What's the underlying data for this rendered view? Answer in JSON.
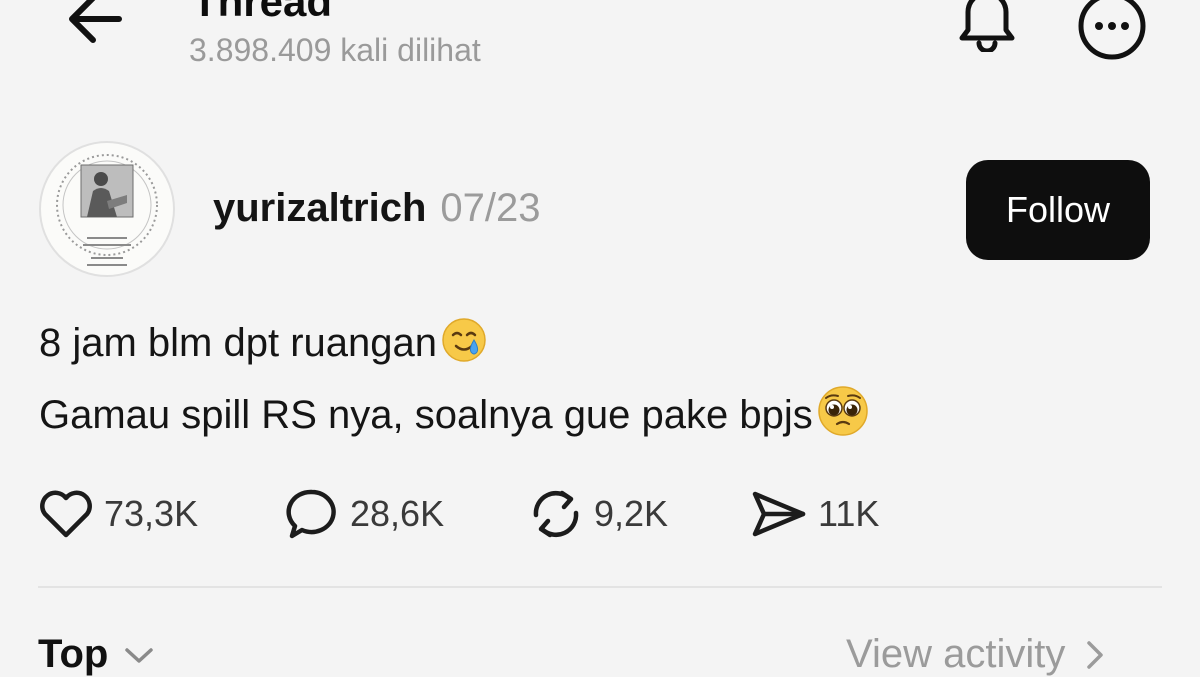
{
  "header": {
    "title": "Thread",
    "views": "3.898.409 kali dilihat"
  },
  "post": {
    "username": "yurizaltrich",
    "date": "07/23",
    "follow_label": "Follow",
    "text_line1": "8 jam blm dpt ruangan",
    "text_line2": "Gamau spill RS nya, soalnya gue pake bpjs",
    "emoji1": "smiling-face-with-tear",
    "emoji2": "pleading-face"
  },
  "actions": {
    "likes": "73,3K",
    "replies": "28,6K",
    "reposts": "9,2K",
    "shares": "11K"
  },
  "footer": {
    "sort_label": "Top",
    "activity_label": "View activity"
  },
  "icons": {
    "back": "arrow-left-icon",
    "bell": "bell-icon",
    "more": "more-icon",
    "like": "heart-icon",
    "reply": "comment-icon",
    "repost": "repost-icon",
    "share": "send-icon"
  },
  "colors": {
    "background": "#f4f4f4",
    "follow_button": "#0e0e0e",
    "secondary_text": "#9b9b9b"
  }
}
